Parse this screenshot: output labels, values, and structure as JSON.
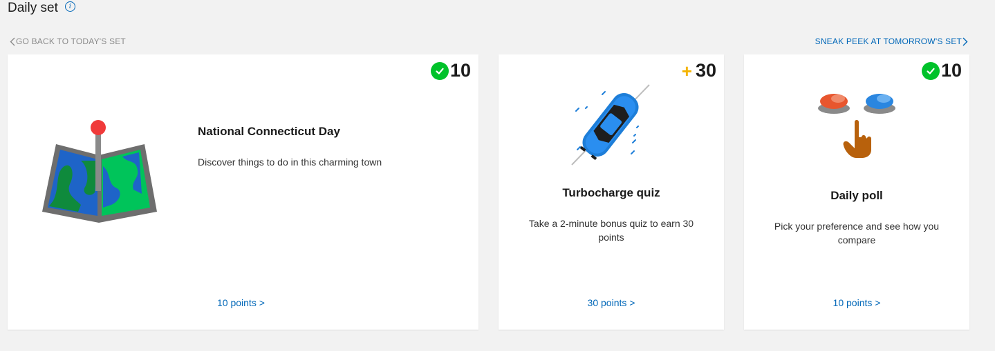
{
  "header": {
    "title": "Daily set",
    "info_icon": "info-icon"
  },
  "nav": {
    "back_label": "GO BACK TO TODAY'S SET",
    "next_label": "SNEAK PEEK AT TOMORROW'S SET"
  },
  "colors": {
    "accent": "#0067b8",
    "completed": "#00c22a",
    "bonus": "#f4b400",
    "background": "#f2f2f2"
  },
  "cards": [
    {
      "badge_icon": "checkmark-icon",
      "points": "10",
      "image": "map-pin-icon",
      "title": "National Connecticut Day",
      "description": "Discover things to do in this charming town",
      "link": "10 points >",
      "completed": true
    },
    {
      "badge_icon": "plus-icon",
      "badge_sign": "+",
      "points": "30",
      "image": "race-car-icon",
      "title": "Turbocharge quiz",
      "description": "Take a 2-minute bonus quiz to earn 30 points",
      "link": "30 points >",
      "completed": false
    },
    {
      "badge_icon": "checkmark-icon",
      "points": "10",
      "image": "poll-buttons-icon",
      "title": "Daily poll",
      "description": "Pick your preference and see how you compare",
      "link": "10 points >",
      "completed": true
    }
  ]
}
